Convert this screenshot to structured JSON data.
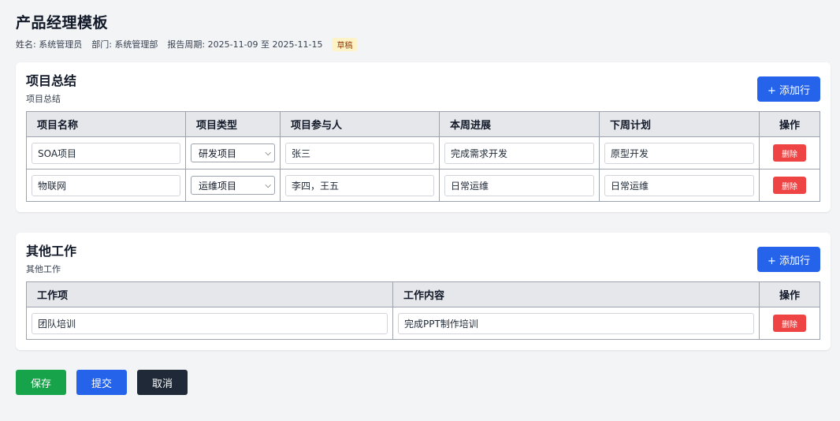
{
  "header": {
    "title": "产品经理模板",
    "name": "姓名: 系统管理员",
    "dept": "部门: 系统管理部",
    "period": "报告周期: 2025-11-09 至 2025-11-15",
    "status": "草稿"
  },
  "projects": {
    "title": "项目总结",
    "subtitle": "项目总结",
    "add_label": "+ 添加行",
    "columns": [
      "项目名称",
      "项目类型",
      "项目参与人",
      "本周进展",
      "下周计划",
      "操作"
    ],
    "rows": [
      {
        "name": "SOA项目",
        "type": "研发项目",
        "members": "张三",
        "progress": "完成需求开发",
        "plan": "原型开发",
        "delete": "删除"
      },
      {
        "name": "物联网",
        "type": "运维项目",
        "members": "李四，王五",
        "progress": "日常运维",
        "plan": "日常运维",
        "delete": "删除"
      }
    ]
  },
  "other": {
    "title": "其他工作",
    "subtitle": "其他工作",
    "add_label": "+ 添加行",
    "columns": [
      "工作项",
      "工作内容",
      "操作"
    ],
    "rows": [
      {
        "item": "团队培训",
        "content": "完成PPT制作培训",
        "delete": "删除"
      }
    ]
  },
  "footer": {
    "save": "保存",
    "submit": "提交",
    "cancel": "取消"
  },
  "colors": {
    "primary": "#2563eb",
    "danger": "#ef4444",
    "success": "#16a34a",
    "dark": "#1f2937",
    "draft_badge": "#fef3c7"
  }
}
